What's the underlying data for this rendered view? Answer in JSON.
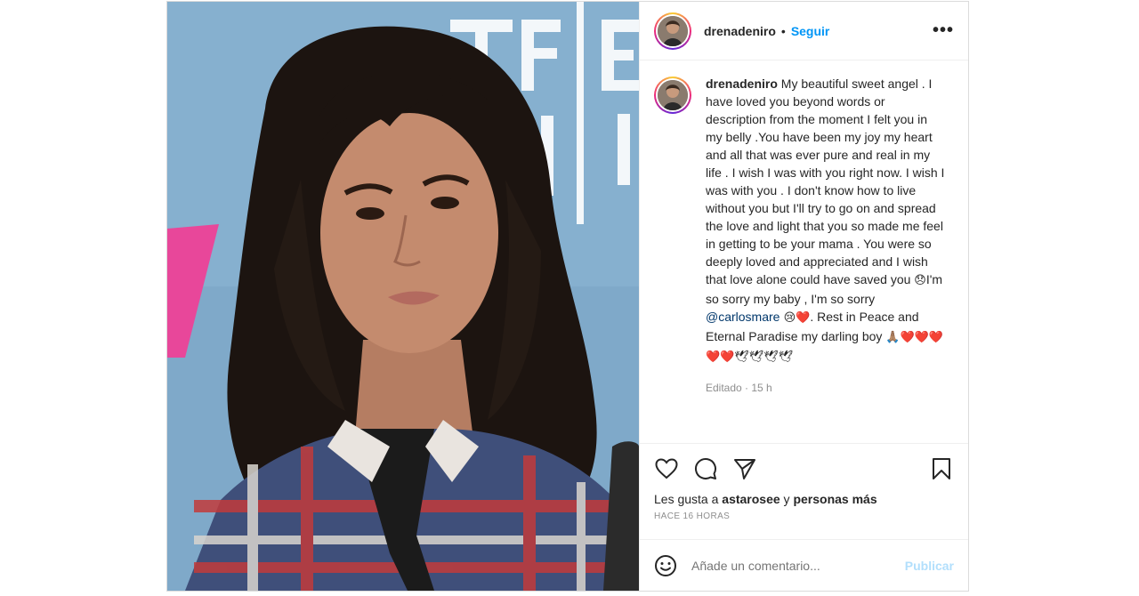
{
  "post": {
    "username": "drenadeniro",
    "separator": "•",
    "follow_label": "Seguir",
    "more_label": "•••",
    "photo_alt": "Fotografía de una persona con cabello largo"
  },
  "caption": {
    "username": "drenadeniro",
    "text_part1": " My beautiful sweet angel . I have loved you beyond words or description from the moment I felt you in my belly .You have been my joy my heart and all that was ever pure and real in my life . I wish I was with you right now. I wish I was with you . I don't know how to live without you but I'll try to go on and spread the love and light that you so made me feel in getting to be your mama . You were so deeply loved and appreciated and I wish that love alone could have saved you ",
    "emoji_1": "😞",
    "text_part2": "I'm so sorry my baby , I'm so sorry ",
    "mention": "@carlosmare",
    "emoji_2": " 😢❤️",
    "text_part3": ". Rest in Peace and Eternal Paradise my darling boy ",
    "emoji_3": "🙏🏽❤️❤️❤️❤️❤️🕊🕊🕊🕊",
    "edited": "Editado",
    "meta_sep": " · ",
    "age": "15 h"
  },
  "likes": {
    "prefix": "Les gusta a ",
    "user": "astarosee",
    "middle": " y ",
    "others": "personas más"
  },
  "timestamp": "HACE 16 HORAS",
  "add_comment": {
    "placeholder": "Añade un comentario...",
    "publish_label": "Publicar"
  },
  "icons": {
    "like": "heart-icon",
    "comment": "comment-icon",
    "share": "share-icon",
    "save": "bookmark-icon",
    "emoji": "smiley-icon"
  },
  "colors": {
    "link": "#0095f6",
    "publish_disabled": "#b2dffc",
    "mention": "#00376b"
  }
}
